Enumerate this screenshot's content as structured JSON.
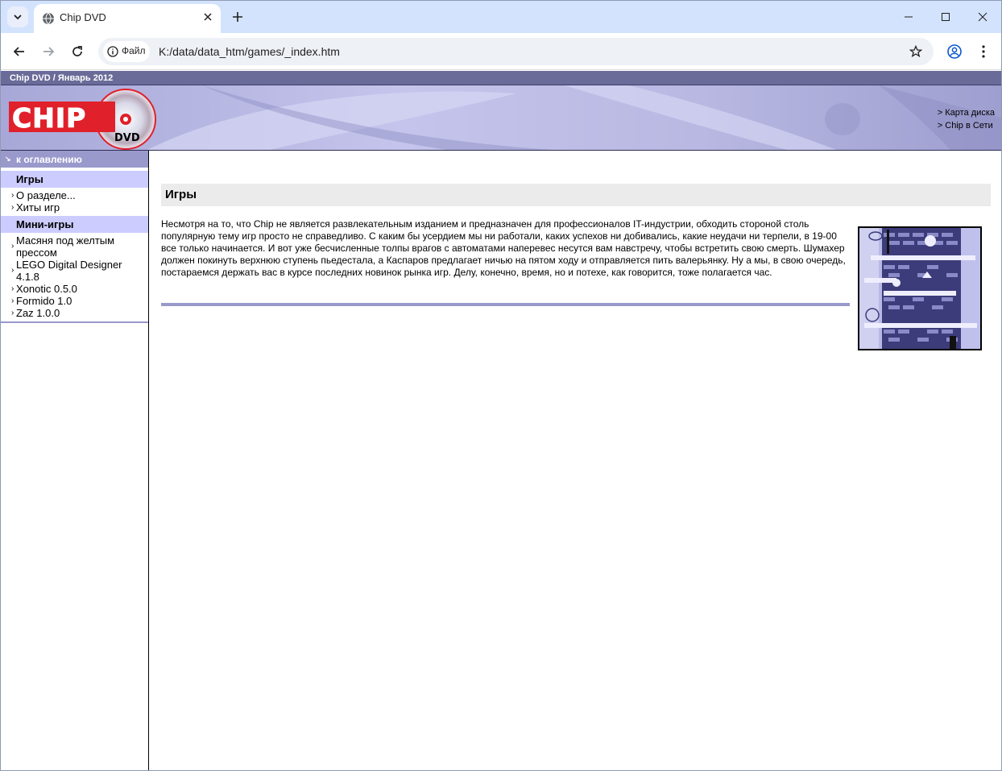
{
  "browser": {
    "tab_title": "Chip DVD",
    "site_chip_label": "Файл",
    "url": "K:/data/data_htm/games/_index.htm"
  },
  "page": {
    "topstrip": "Chip DVD / Январь 2012",
    "logo_text": "CHIP",
    "logo_dvd": "DVD",
    "banner_links": [
      "> Карта диска",
      "> Chip в Сети"
    ],
    "sidebar": {
      "toc": "к оглавлению",
      "section1": "Игры",
      "section1_items": [
        "О разделе...",
        "Хиты игр"
      ],
      "section2": "Мини-игры",
      "section2_items": [
        "Масяня под желтым прессом",
        "LEGO Digital Designer 4.1.8",
        "Xonotic 0.5.0",
        "Formido 1.0",
        "Zaz 1.0.0"
      ]
    },
    "heading": "Игры",
    "paragraph": "Несмотря на то, что Chip не является развлекательным изданием и предназначен для профессионалов IT-индустрии, обходить стороной столь популярную тему игр просто не справедливо. С каким бы усердием мы ни работали, каких успехов ни добивались, какие неудачи ни терпели, в 19-00 все только начинается. И вот уже бесчисленные толпы врагов с автоматами наперевес несутся вам навстречу, чтобы встретить свою смерть. Шумахер должен покинуть верхнюю ступень пьедестала, а Каспаров предлагает ничью на пятом ходу и отправляется пить валерьянку. Ну а мы, в свою очередь, постараемся держать вас в курсе последних новинок рынка игр. Делу, конечно, время, но и потехе, как говорится, тоже полагается час."
  },
  "colors": {
    "tabstrip": "#d3e3fd",
    "sidebar_toc": "#9999cc",
    "sidebar_head": "#ccccff",
    "logo_red": "#e0202a"
  },
  "icons": [
    "chevron-down-icon",
    "globe-icon",
    "close-icon",
    "plus-icon",
    "minimize-icon",
    "maximize-icon",
    "back-icon",
    "forward-icon",
    "reload-icon",
    "info-icon",
    "star-icon",
    "profile-icon",
    "more-icon"
  ]
}
